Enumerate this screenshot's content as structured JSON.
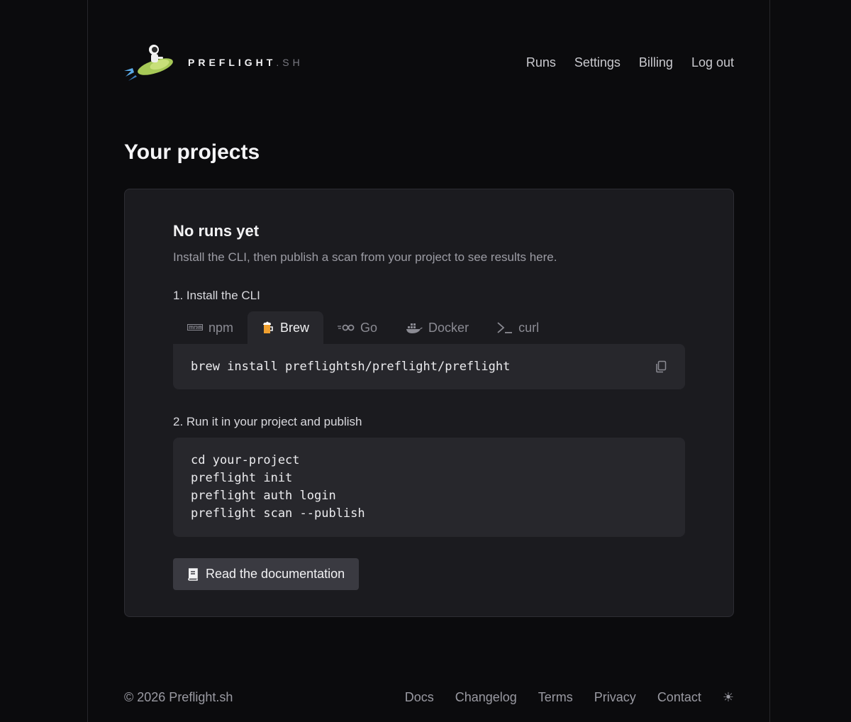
{
  "brand": {
    "name": "PREFLIGHT",
    "suffix": ".SH"
  },
  "nav": {
    "runs": "Runs",
    "settings": "Settings",
    "billing": "Billing",
    "logout": "Log out"
  },
  "page": {
    "title": "Your projects"
  },
  "empty_state": {
    "title": "No runs yet",
    "subtitle": "Install the CLI, then publish a scan from your project to see results here."
  },
  "install": {
    "label": "1. Install the CLI",
    "tabs": [
      {
        "label": "npm",
        "icon": "npm-icon"
      },
      {
        "label": "Brew",
        "icon": "beer-icon",
        "active": true
      },
      {
        "label": "Go",
        "icon": "go-icon"
      },
      {
        "label": "Docker",
        "icon": "docker-icon"
      },
      {
        "label": "curl",
        "icon": "terminal-icon"
      }
    ],
    "command": "brew install preflightsh/preflight/preflight"
  },
  "run": {
    "label": "2. Run it in your project and publish",
    "lines": [
      "cd your-project",
      "preflight init",
      "preflight auth login",
      "preflight scan --publish"
    ]
  },
  "docs_button": {
    "label": "Read the documentation",
    "icon": "book-icon"
  },
  "footer": {
    "copyright": "© 2026 Preflight.sh",
    "links": {
      "docs": "Docs",
      "changelog": "Changelog",
      "terms": "Terms",
      "privacy": "Privacy",
      "contact": "Contact"
    },
    "theme_toggle": "☀"
  },
  "colors": {
    "background": "#0b0b0d",
    "card": "#1b1b1f",
    "code": "#27272c",
    "button": "#3a3a41"
  }
}
